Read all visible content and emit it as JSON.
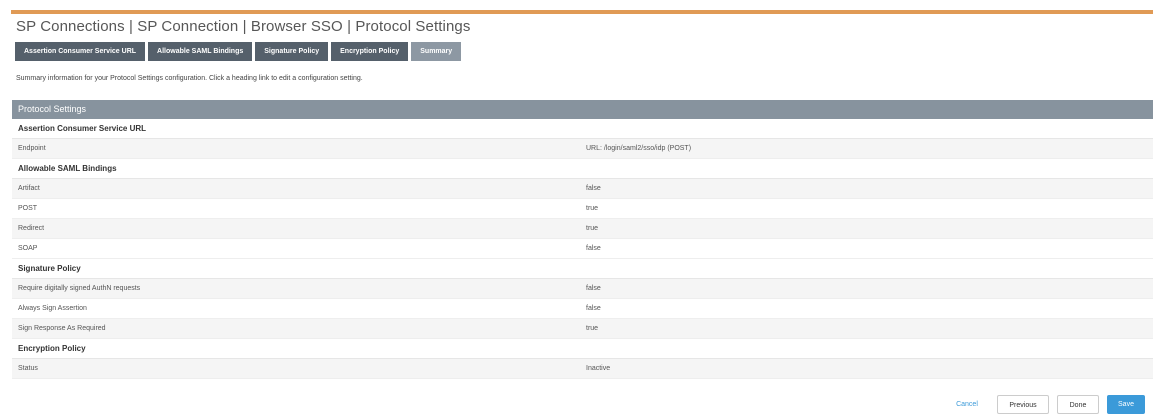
{
  "page": {
    "title": "SP Connections | SP Connection | Browser SSO | Protocol Settings",
    "intro": "Summary information for your Protocol Settings configuration. Click a heading link to edit a configuration setting.",
    "accent_color": "#e09a55"
  },
  "tabs": [
    {
      "label": "Assertion Consumer Service URL",
      "active": false
    },
    {
      "label": "Allowable SAML Bindings",
      "active": false
    },
    {
      "label": "Signature Policy",
      "active": false
    },
    {
      "label": "Encryption Policy",
      "active": false
    },
    {
      "label": "Summary",
      "active": true
    }
  ],
  "summary": {
    "section_title": "Protocol Settings",
    "groups": [
      {
        "heading": "Assertion Consumer Service URL",
        "rows": [
          {
            "label": "Endpoint",
            "value": "URL: /login/saml2/sso/idp (POST)"
          }
        ]
      },
      {
        "heading": "Allowable SAML Bindings",
        "rows": [
          {
            "label": "Artifact",
            "value": "false"
          },
          {
            "label": "POST",
            "value": "true"
          },
          {
            "label": "Redirect",
            "value": "true"
          },
          {
            "label": "SOAP",
            "value": "false"
          }
        ]
      },
      {
        "heading": "Signature Policy",
        "rows": [
          {
            "label": "Require digitally signed AuthN requests",
            "value": "false"
          },
          {
            "label": "Always Sign Assertion",
            "value": "false"
          },
          {
            "label": "Sign Response As Required",
            "value": "true"
          }
        ]
      },
      {
        "heading": "Encryption Policy",
        "rows": [
          {
            "label": "Status",
            "value": "Inactive"
          }
        ]
      }
    ]
  },
  "buttons": {
    "cancel": "Cancel",
    "previous": "Previous",
    "done": "Done",
    "save": "Save"
  }
}
